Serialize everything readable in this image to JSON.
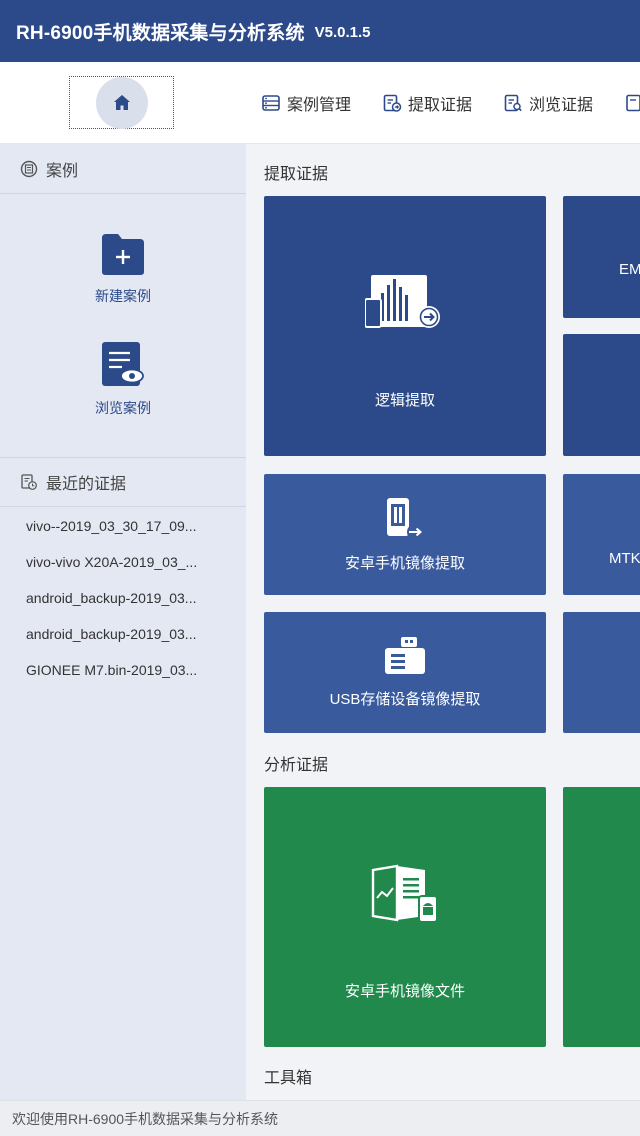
{
  "app": {
    "title": "RH-6900手机数据采集与分析系统",
    "version": "V5.0.1.5"
  },
  "toolbar": {
    "home_icon": "home-icon",
    "items": [
      {
        "label": "案例管理",
        "icon": "case-manage-icon"
      },
      {
        "label": "提取证据",
        "icon": "extract-evidence-icon"
      },
      {
        "label": "浏览证据",
        "icon": "browse-evidence-icon"
      },
      {
        "label": "",
        "icon": "report-icon"
      }
    ]
  },
  "sidebar": {
    "case_header": "案例",
    "new_case": "新建案例",
    "browse_case": "浏览案例",
    "recent_header": "最近的证据",
    "recent_items": [
      "vivo--2019_03_30_17_09...",
      "vivo-vivo X20A-2019_03_...",
      "android_backup-2019_03...",
      "android_backup-2019_03...",
      "GIONEE M7.bin-2019_03..."
    ]
  },
  "main": {
    "extract_title": "提取证据",
    "extract_tiles": [
      {
        "label": "逻辑提取"
      },
      {
        "label": "EM"
      },
      {
        "label": ""
      },
      {
        "label": "安卓手机镜像提取"
      },
      {
        "label": "MTK"
      },
      {
        "label": "USB存储设备镜像提取"
      },
      {
        "label": ""
      }
    ],
    "analyze_title": "分析证据",
    "analyze_tiles": [
      {
        "label": "安卓手机镜像文件"
      },
      {
        "label": ""
      }
    ],
    "toolbox_title": "工具箱"
  },
  "status": {
    "text": "欢迎使用RH-6900手机数据采集与分析系统"
  },
  "colors": {
    "primary": "#2c4a8a",
    "tile_blue": "#3a5a9e",
    "tile_green": "#21894c",
    "sidebar_bg": "#e3e8f3"
  }
}
